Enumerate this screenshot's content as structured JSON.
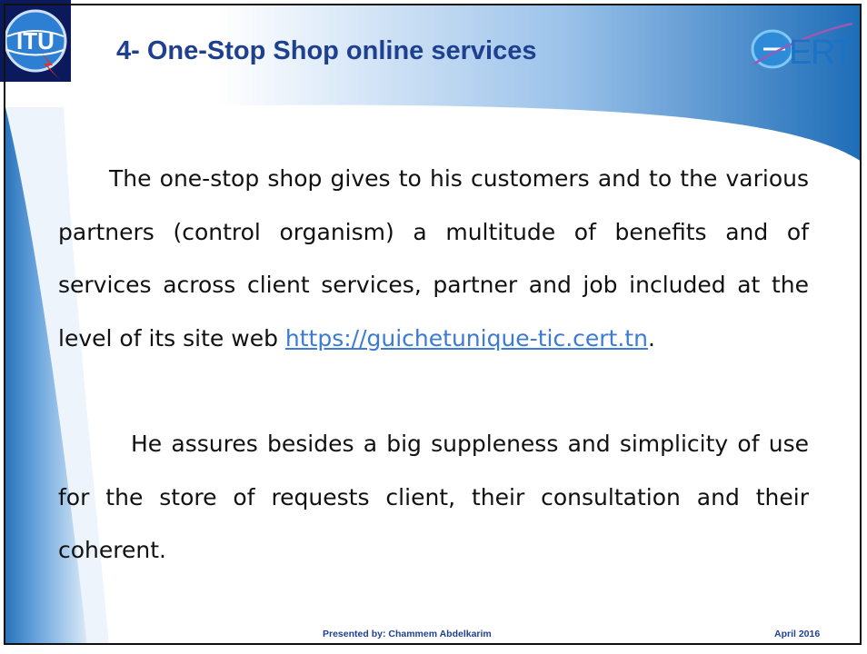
{
  "slide": {
    "title": "4- One-Stop Shop online services",
    "paragraph1": {
      "text": "The one-stop shop gives to his customers and to the various partners (control organism) a multitude of benefits and of services across client services, partner and job included at the level of its site web ",
      "link": "https://guichetunique-tic.cert.tn",
      "tail": "."
    },
    "paragraph2": {
      "text": "He assures besides a big suppleness and simplicity of use for the store of requests client, their consultation and their coherent."
    },
    "logos": {
      "left": {
        "name": "itu-logo",
        "text": "ITU"
      },
      "right": {
        "name": "cert-logo",
        "text": "CERT"
      }
    }
  },
  "footer": {
    "presenter_label": "Presented by",
    "presenter_name": ": Chammem Abdelkarim",
    "date": "April 2016"
  },
  "colors": {
    "title": "#1F3F8F",
    "swoosh": "#2E7CC2",
    "swoosh_light": "#CFE2F5",
    "link": "#3B7BD4",
    "text": "#111111"
  }
}
